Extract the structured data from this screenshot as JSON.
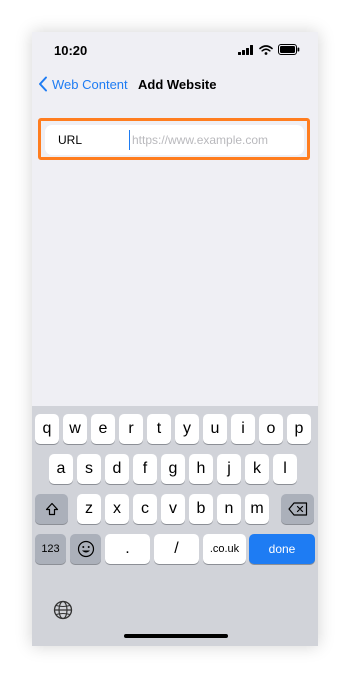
{
  "status_bar": {
    "time": "10:20"
  },
  "nav": {
    "back_label": "Web Content",
    "title": "Add Website"
  },
  "form": {
    "url_label": "URL",
    "url_value": "",
    "url_placeholder": "https://www.example.com"
  },
  "keyboard": {
    "row1": [
      "q",
      "w",
      "e",
      "r",
      "t",
      "y",
      "u",
      "i",
      "o",
      "p"
    ],
    "row2": [
      "a",
      "s",
      "d",
      "f",
      "g",
      "h",
      "j",
      "k",
      "l"
    ],
    "row3": [
      "z",
      "x",
      "c",
      "v",
      "b",
      "n",
      "m"
    ],
    "numbers_key": "123",
    "dot_key": ".",
    "slash_key": "/",
    "couk_key": ".co.uk",
    "done_key": "done"
  },
  "colors": {
    "accent": "#1e7cf3",
    "highlight": "#ff7d1f",
    "background": "#efeff4",
    "keyboard": "#d1d3d9"
  },
  "icons": [
    "cellular-signal-icon",
    "wifi-icon",
    "battery-icon",
    "chevron-left-icon",
    "shift-icon",
    "backspace-icon",
    "emoji-icon",
    "globe-icon"
  ]
}
